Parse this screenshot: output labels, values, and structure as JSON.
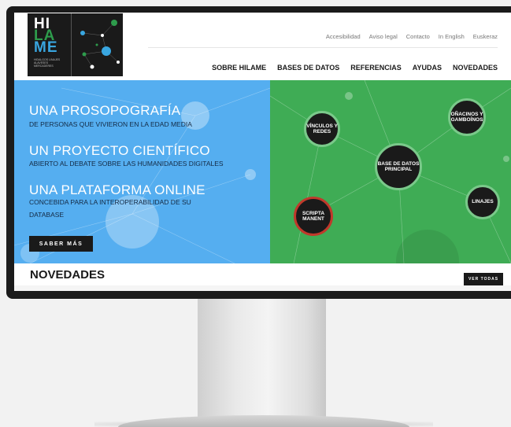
{
  "logo": {
    "line1": "HI",
    "line2": "LA",
    "line3": "ME",
    "subtitle": "HIDALGOS LINAJES ALAVESES MERCADERES"
  },
  "topnav": [
    "Accesibilidad",
    "Aviso legal",
    "Contacto",
    "In English",
    "Euskeraz"
  ],
  "mainnav": [
    "SOBRE HILAME",
    "BASES DE DATOS",
    "REFERENCIAS",
    "AYUDAS",
    "NOVEDADES"
  ],
  "hero": {
    "heading1": "UNA PROSOPOGRAFÍA",
    "sub1": "DE PERSONAS QUE VIVIERON EN LA EDAD MEDIA",
    "heading2": "UN PROYECTO CIENTÍFICO",
    "sub2": "ABIERTO AL DEBATE SOBRE LAS HUMANIDADES DIGITALES",
    "heading3": "UNA PLATAFORMA ONLINE",
    "sub3a": "CONCEBIDA PARA LA INTEROPERABILIDAD DE SU",
    "sub3b": "DATABASE",
    "button": "SABER MÁS"
  },
  "bubbles": {
    "vinculos": "VÍNCULOS Y REDES",
    "onacinos": "OÑACINOS Y GAMBOÍNOS",
    "base": "BASE DE DATOS PRINCIPAL",
    "linajes": "LINAJES",
    "scripta": "SCRIPTA MANENT"
  },
  "novedades": {
    "title": "NOVEDADES",
    "button": "VER TODAS"
  },
  "colors": {
    "hero_blue": "#55aef0",
    "hero_green": "#3fac55",
    "dark": "#1a1a1a",
    "accent_red": "#c0392b"
  }
}
